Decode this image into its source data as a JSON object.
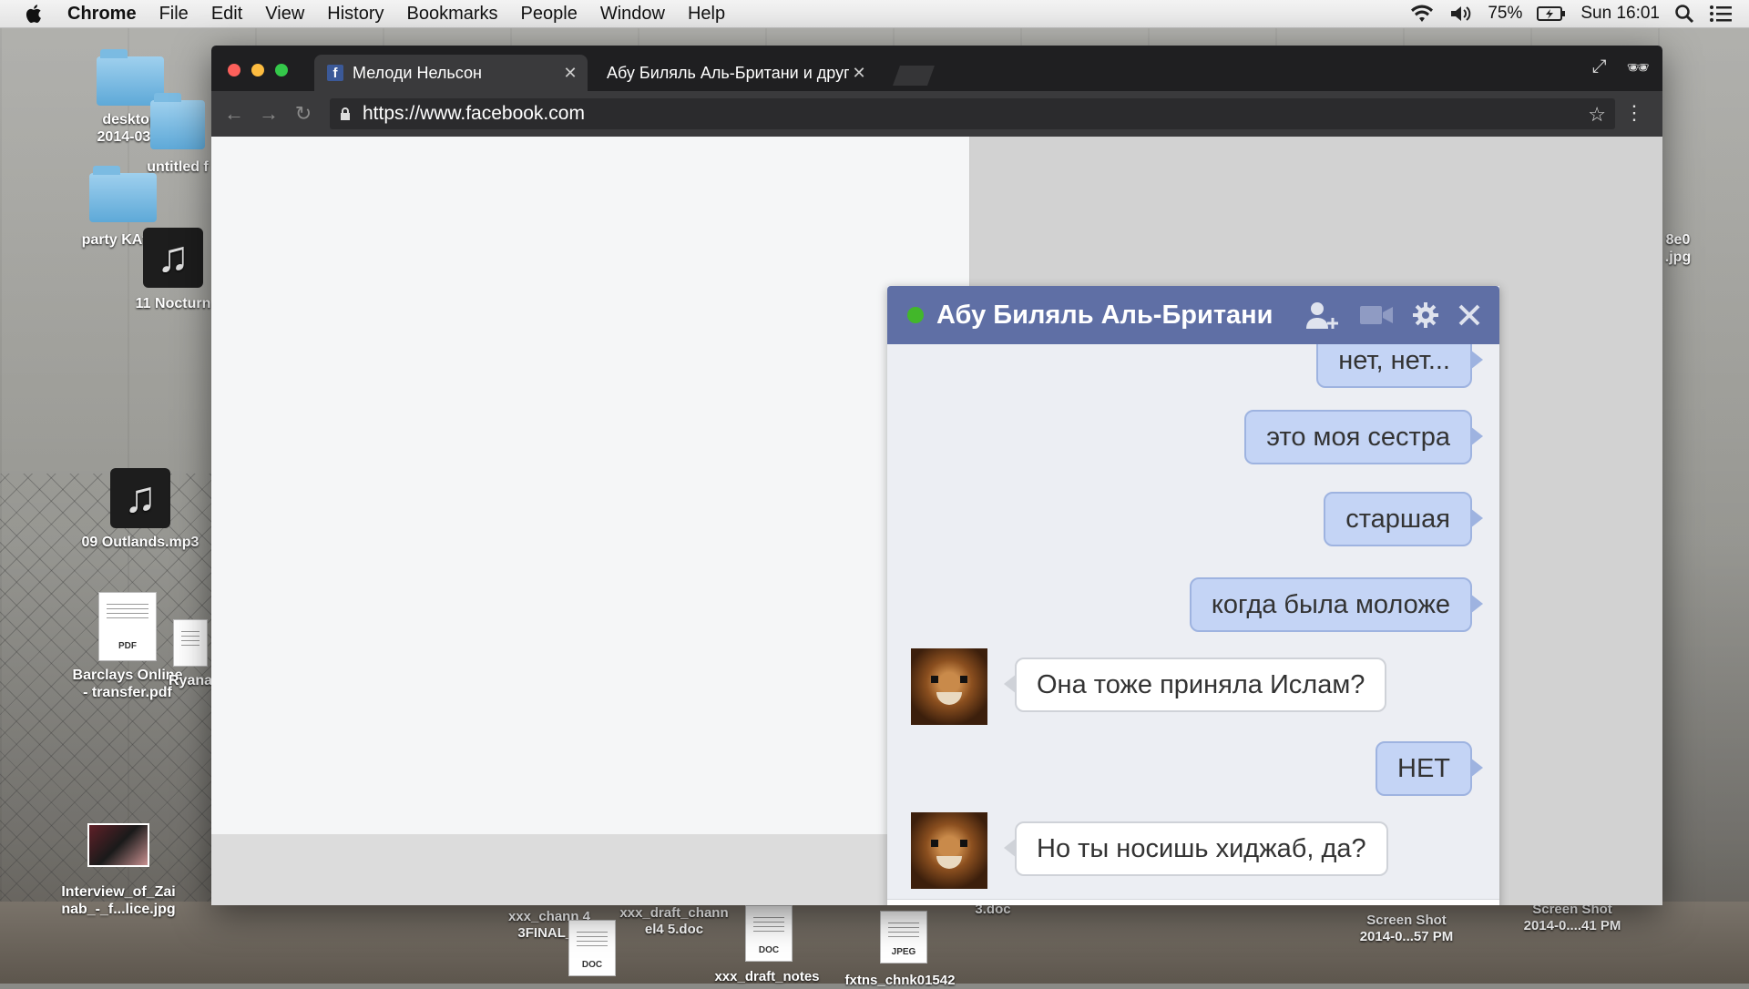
{
  "menubar": {
    "app": "Chrome",
    "items": [
      "File",
      "Edit",
      "View",
      "History",
      "Bookmarks",
      "People",
      "Window",
      "Help"
    ],
    "battery": "75%",
    "clock": "Sun 16:01"
  },
  "desktop": {
    "icons": [
      {
        "label": "desktop\n2014-03-2",
        "kind": "folder"
      },
      {
        "label": "untitled f",
        "kind": "folder"
      },
      {
        "label": "party KAthy",
        "kind": "folder"
      },
      {
        "label": "11 Nocturn",
        "kind": "music"
      },
      {
        "label": "09 Outlands.mp3",
        "kind": "music"
      },
      {
        "label": "Barclays Online\n- transfer.pdf",
        "kind": "pdf"
      },
      {
        "label": "Ryana",
        "kind": "pdf"
      },
      {
        "label": "Interview_of_Zai\nnab_-_f...lice.jpg",
        "kind": "photo"
      },
      {
        "label": "8e0\n.jpg",
        "kind": "file"
      }
    ],
    "bottom_files": [
      {
        "label": "xxx_chann 4\n3FINAL_0"
      },
      {
        "label": "xxx_draft_chann\nel4 5.doc"
      },
      {
        "label": "3.doc"
      },
      {
        "label": "xxx_draft_notes"
      },
      {
        "label": "fxtns_chnk01542"
      },
      {
        "label": "Screen Shot\n2014-0...57 PM"
      },
      {
        "label": "Screen Shot\n2014-0....41 PM"
      }
    ],
    "doc_badge": "DOC",
    "jpeg_badge": "JPEG",
    "pdf_badge": "PDF"
  },
  "browser": {
    "tabs": [
      {
        "title": "Мелоди Нельсон",
        "active": true
      },
      {
        "title": "Абу Биляль Аль-Британи и друг",
        "active": false
      }
    ],
    "url": "https://www.facebook.com",
    "fb_letter": "f"
  },
  "chat": {
    "contact": "Абу Биляль Аль-Британи",
    "messages": [
      {
        "from": "me",
        "text": "нет, нет..."
      },
      {
        "from": "me",
        "text": "это моя сестра"
      },
      {
        "from": "me",
        "text": "старшая"
      },
      {
        "from": "me",
        "text": "когда была моложе"
      },
      {
        "from": "them",
        "text": "Она тоже приняла Ислам?"
      },
      {
        "from": "me",
        "text": "НЕТ"
      },
      {
        "from": "them",
        "text": "Но ты носишь хиджаб, да?"
      }
    ],
    "colors": {
      "header": "#5f6fa5",
      "online": "#42b72a",
      "my_bubble": "#c4d4f5"
    }
  }
}
